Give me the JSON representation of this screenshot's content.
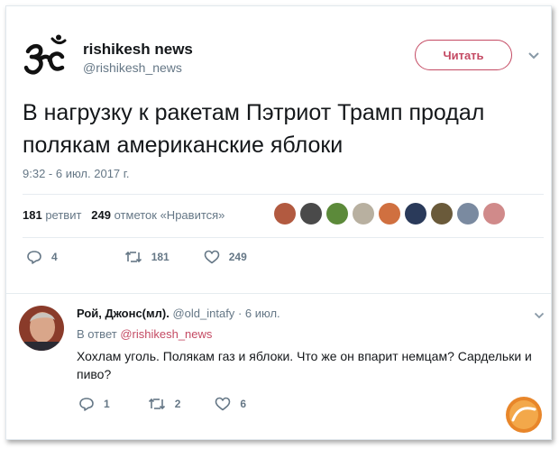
{
  "tweet": {
    "author_name": "rishikesh news",
    "author_handle": "@rishikesh_news",
    "follow_label": "Читать",
    "text": "В нагрузку к ракетам Пэтриот Трамп продал полякам американские яблоки",
    "timestamp": "9:32 - 6 июл. 2017 г.",
    "retweets_count": "181",
    "retweets_label": "ретвит",
    "likes_count": "249",
    "likes_label": "отметок «Нравится»",
    "liker_avatar_colors": [
      "#b25a40",
      "#4a4a4a",
      "#5c8a3a",
      "#b8b0a0",
      "#d07040",
      "#2a3a5a",
      "#6a5a3a",
      "#7a8aa0",
      "#d08a8a"
    ],
    "actions": {
      "reply": "4",
      "retweet": "181",
      "like": "249"
    }
  },
  "reply": {
    "name": "Рой, Джонс(мл).",
    "handle": "@old_intafy",
    "time": "· 6 июл.",
    "in_reply_prefix": "В ответ",
    "in_reply_to": "@rishikesh_news",
    "text": "Хохлам уголь. Полякам газ и яблоки. Что же он впарит немцам? Сардельки и пиво?",
    "actions": {
      "reply": "1",
      "retweet": "2",
      "like": "6"
    }
  },
  "colors": {
    "accent": "#c44a63",
    "muted": "#657786",
    "text": "#14171a"
  },
  "icons": [
    "om-logo-icon",
    "chevron-down-icon",
    "reply-icon",
    "retweet-icon",
    "like-icon",
    "watermark-logo-icon"
  ]
}
